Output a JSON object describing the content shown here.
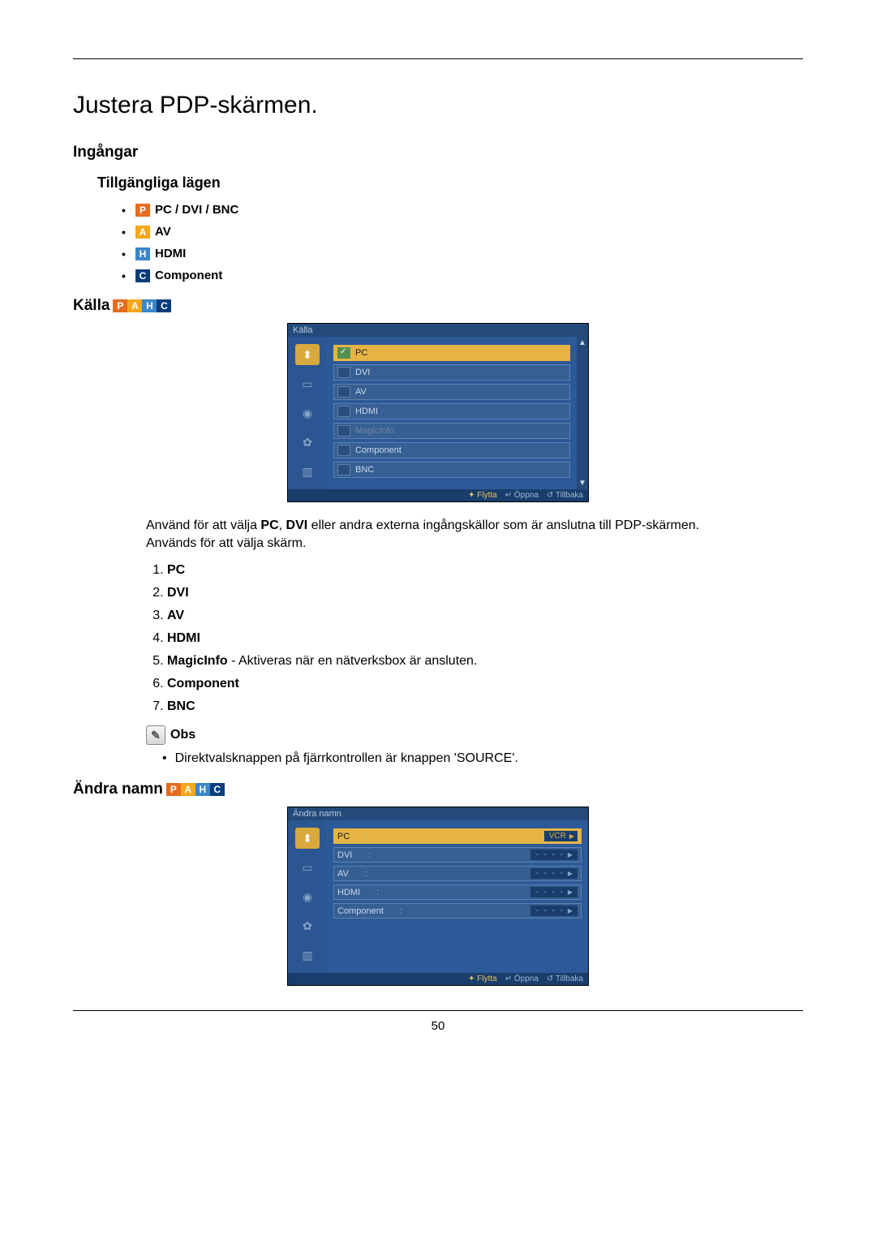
{
  "title": "Justera PDP-skärmen.",
  "section_inputs": "Ingångar",
  "available_modes_heading": "Tillgängliga lägen",
  "modes": [
    {
      "badge": "P",
      "label": "PC / DVI / BNC",
      "cls": "b-p"
    },
    {
      "badge": "A",
      "label": "AV",
      "cls": "b-a"
    },
    {
      "badge": "H",
      "label": "HDMI",
      "cls": "b-h"
    },
    {
      "badge": "C",
      "label": "Component",
      "cls": "b-c"
    }
  ],
  "source_heading": "Källa",
  "osd1": {
    "title": "Källa",
    "rows": [
      {
        "label": "PC",
        "sel": true
      },
      {
        "label": "DVI"
      },
      {
        "label": "AV"
      },
      {
        "label": "HDMI"
      },
      {
        "label": "MagicInfo",
        "dim": true
      },
      {
        "label": "Component"
      },
      {
        "label": "BNC"
      }
    ],
    "foot_move": "Flytta",
    "foot_open": "Öppna",
    "foot_back": "Tillbaka"
  },
  "source_desc_pre": "Använd för att välja ",
  "source_desc_pc": "PC",
  "source_desc_sep": ", ",
  "source_desc_dvi": "DVI",
  "source_desc_rest": " eller andra externa ingångskällor som är anslutna till PDP-skärmen. Används för att välja skärm.",
  "source_list": [
    {
      "strong": "PC"
    },
    {
      "strong": "DVI"
    },
    {
      "strong": "AV"
    },
    {
      "strong": "HDMI"
    },
    {
      "strong": "MagicInfo",
      "rest": " - Aktiveras när en nätverksbox är ansluten."
    },
    {
      "strong": "Component"
    },
    {
      "strong": "BNC"
    }
  ],
  "obs_label": "Obs",
  "obs_note": "Direktvalsknappen på fjärrkontrollen är knappen 'SOURCE'.",
  "rename_heading": "Ändra namn",
  "osd2": {
    "title": "Ändra namn",
    "rows": [
      {
        "label": "PC",
        "value": "VCR",
        "sel": true
      },
      {
        "label": "DVI",
        "value": "- - - -"
      },
      {
        "label": "AV",
        "value": "- - - -"
      },
      {
        "label": "HDMI",
        "value": "- - - -"
      },
      {
        "label": "Component",
        "value": "- - - -"
      }
    ],
    "foot_move": "Flytta",
    "foot_open": "Öppna",
    "foot_back": "Tillbaka"
  },
  "page_number": "50"
}
